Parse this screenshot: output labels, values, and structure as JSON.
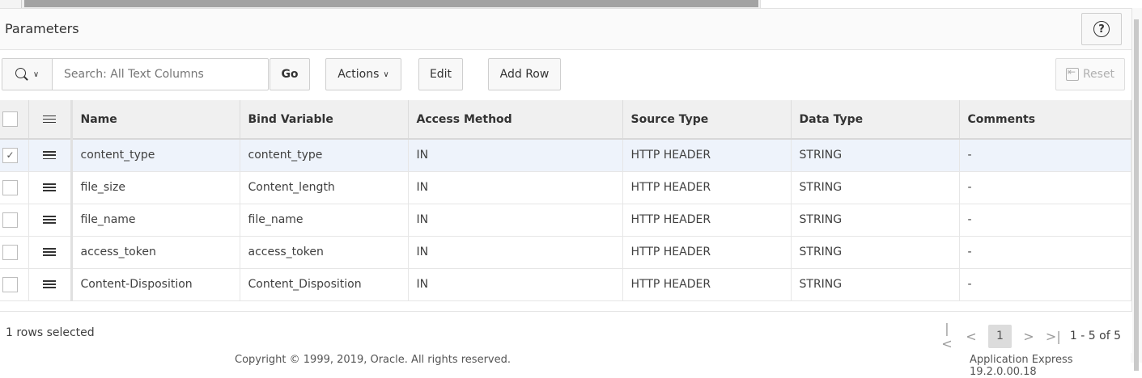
{
  "region": {
    "title": "Parameters",
    "help_icon": "question-circle-icon"
  },
  "toolbar": {
    "search_placeholder": "Search: All Text Columns",
    "go_label": "Go",
    "actions_label": "Actions",
    "edit_label": "Edit",
    "add_row_label": "Add Row",
    "reset_label": "Reset"
  },
  "grid": {
    "columns": [
      "Name",
      "Bind Variable",
      "Access Method",
      "Source Type",
      "Data Type",
      "Comments"
    ],
    "rows": [
      {
        "selected": true,
        "name": "content_type",
        "bind": "content_type",
        "access": "IN",
        "source": "HTTP HEADER",
        "dtype": "STRING",
        "comments": "-"
      },
      {
        "selected": false,
        "name": "file_size",
        "bind": "Content_length",
        "access": "IN",
        "source": "HTTP HEADER",
        "dtype": "STRING",
        "comments": "-"
      },
      {
        "selected": false,
        "name": "file_name",
        "bind": "file_name",
        "access": "IN",
        "source": "HTTP HEADER",
        "dtype": "STRING",
        "comments": "-"
      },
      {
        "selected": false,
        "name": "access_token",
        "bind": "access_token",
        "access": "IN",
        "source": "HTTP HEADER",
        "dtype": "STRING",
        "comments": "-"
      },
      {
        "selected": false,
        "name": "Content-Disposition",
        "bind": "Content_Disposition",
        "access": "IN",
        "source": "HTTP HEADER",
        "dtype": "STRING",
        "comments": "-"
      }
    ]
  },
  "footer": {
    "rows_selected": "1 rows selected",
    "current_page": "1",
    "range": "1 - 5 of 5"
  },
  "page_footer": {
    "copyright": "Copyright © 1999, 2019, Oracle. All rights reserved.",
    "version": "Application Express 19.2.0.00.18"
  }
}
